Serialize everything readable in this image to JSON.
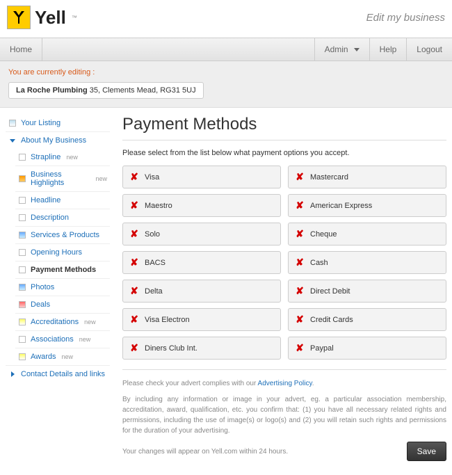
{
  "header": {
    "brand": "Yell",
    "tm": "™",
    "subtitle": "Edit my business"
  },
  "topnav": {
    "home": "Home",
    "admin": "Admin",
    "help": "Help",
    "logout": "Logout"
  },
  "editing": {
    "msg": "You are currently editing :",
    "business_name": "La Roche Plumbing",
    "business_addr": " 35, Clements Mead, RG31 5UJ"
  },
  "sidebar": {
    "your_listing": "Your Listing",
    "about": "About My Business",
    "items": [
      {
        "label": "Strapline",
        "new": "new"
      },
      {
        "label": "Business Highlights",
        "new": "new"
      },
      {
        "label": "Headline",
        "new": ""
      },
      {
        "label": "Description",
        "new": ""
      },
      {
        "label": "Services & Products",
        "new": ""
      },
      {
        "label": "Opening Hours",
        "new": ""
      },
      {
        "label": "Payment Methods",
        "new": ""
      },
      {
        "label": "Photos",
        "new": ""
      },
      {
        "label": "Deals",
        "new": ""
      },
      {
        "label": "Accreditations",
        "new": "new"
      },
      {
        "label": "Associations",
        "new": "new"
      },
      {
        "label": "Awards",
        "new": "new"
      }
    ],
    "contact": "Contact Details and links"
  },
  "main": {
    "title": "Payment Methods",
    "instruct": "Please select from the list below what payment options you accept.",
    "methods": [
      "Visa",
      "Mastercard",
      "Maestro",
      "American Express",
      "Solo",
      "Cheque",
      "BACS",
      "Cash",
      "Delta",
      "Direct Debit",
      "Visa Electron",
      "Credit Cards",
      "Diners Club Int.",
      "Paypal"
    ],
    "footer1_pre": "Please check your advert complies with our ",
    "footer1_link": "Advertising Policy",
    "footer1_post": ".",
    "footer2": "By including any information or image in your advert, eg. a particular association membership, accreditation, award, qualification, etc. you confirm that: (1) you have all necessary related rights and permissions, including the use of image(s) or logo(s) and (2) you will retain such rights and permissions for the duration of your advertising.",
    "footer3": "Your changes will appear on Yell.com within 24 hours.",
    "save": "Save"
  }
}
